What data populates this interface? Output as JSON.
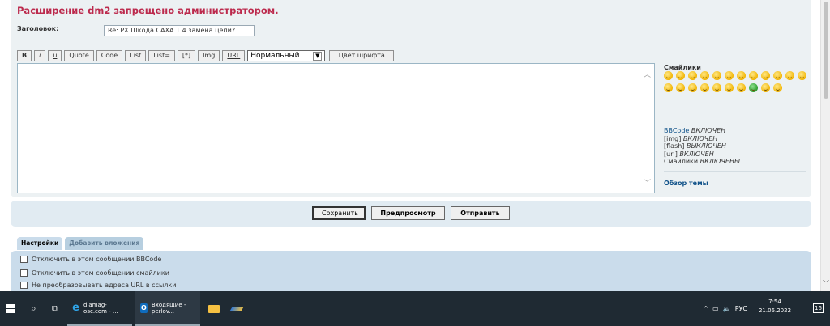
{
  "error_message": "Расширение dm2 запрещено администратором.",
  "subject": {
    "label": "Заголовок:",
    "value": "Re: PX Шкода CAXA 1.4 замена цепи?"
  },
  "toolbar": {
    "bold": "B",
    "italic": "i",
    "underline": "u",
    "quote": "Quote",
    "code": "Code",
    "list": "List",
    "list_ordered": "List=",
    "list_item": "[*]",
    "img": "Img",
    "url": "URL",
    "font_size": "Нормальный",
    "font_color": "Цвет шрифта"
  },
  "sidebar": {
    "smilies_title": "Смайлики",
    "bbcode_label": "BBCode",
    "bbcode_state": "ВКЛЮЧЕН",
    "img_label": "[img]",
    "img_state": "ВКЛЮЧЕН",
    "flash_label": "[flash]",
    "flash_state": "ВЫКЛЮЧЕН",
    "url_label": "[url]",
    "url_state": "ВКЛЮЧЕН",
    "smilies_label": "Смайлики",
    "smilies_state": "ВКЛЮЧЕНЫ",
    "review_link": "Обзор темы"
  },
  "actions": {
    "save": "Сохранить",
    "preview": "Предпросмотр",
    "submit": "Отправить"
  },
  "tabs": [
    {
      "label": "Настройки"
    },
    {
      "label": "Добавить вложения"
    }
  ],
  "options": [
    "Отключить в этом сообщении BBCode",
    "Отключить в этом сообщении смайлики",
    "Не преобразовывать адреса URL в ссылки"
  ],
  "taskbar": {
    "ie_label": "diamag-osc.com - ...",
    "outlook_label": "Входящие - perlov...",
    "lang": "РУС",
    "time": "7:54",
    "date": "21.06.2022",
    "notif_count": "16"
  },
  "colors": {
    "error": "#bc2a4d",
    "link": "#105289",
    "panel": "#ecf1f3",
    "taskbar": "#1f2a33"
  }
}
